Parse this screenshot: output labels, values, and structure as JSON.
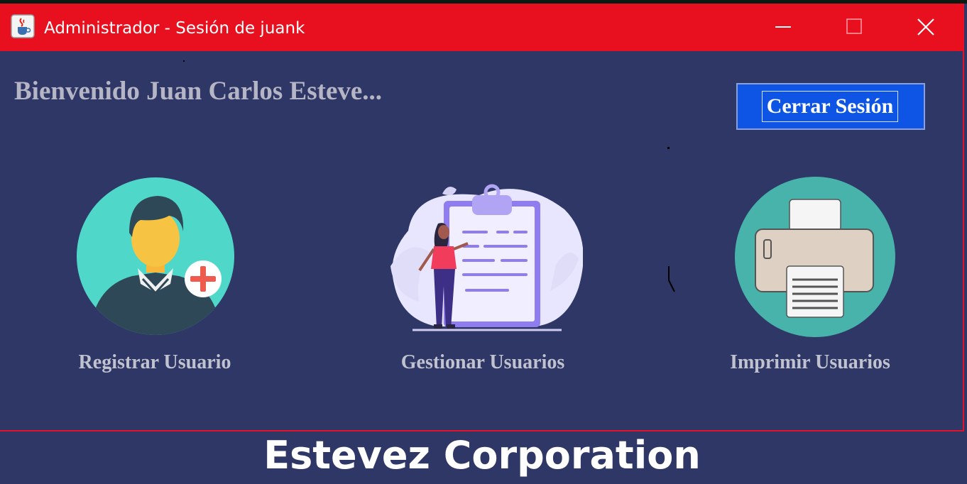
{
  "window": {
    "title": "Administrador - Sesión de juank",
    "icon": "java-cup-icon",
    "controls": [
      "minimize-icon",
      "maximize-icon",
      "close-icon"
    ],
    "titlebar_color": "#e8101f"
  },
  "main": {
    "welcome": "Bienvenido Juan Carlos Esteve...",
    "logout_label": "Cerrar Sesión",
    "logout_color": "#0e55e6",
    "background": "#2e3765",
    "options": [
      {
        "label": "Registrar Usuario",
        "icon": "add-user-icon"
      },
      {
        "label": "Gestionar Usuarios",
        "icon": "clipboard-user-icon"
      },
      {
        "label": "Imprimir Usuarios",
        "icon": "printer-icon"
      }
    ]
  },
  "footer": {
    "caption": "Estevez Corporation"
  }
}
